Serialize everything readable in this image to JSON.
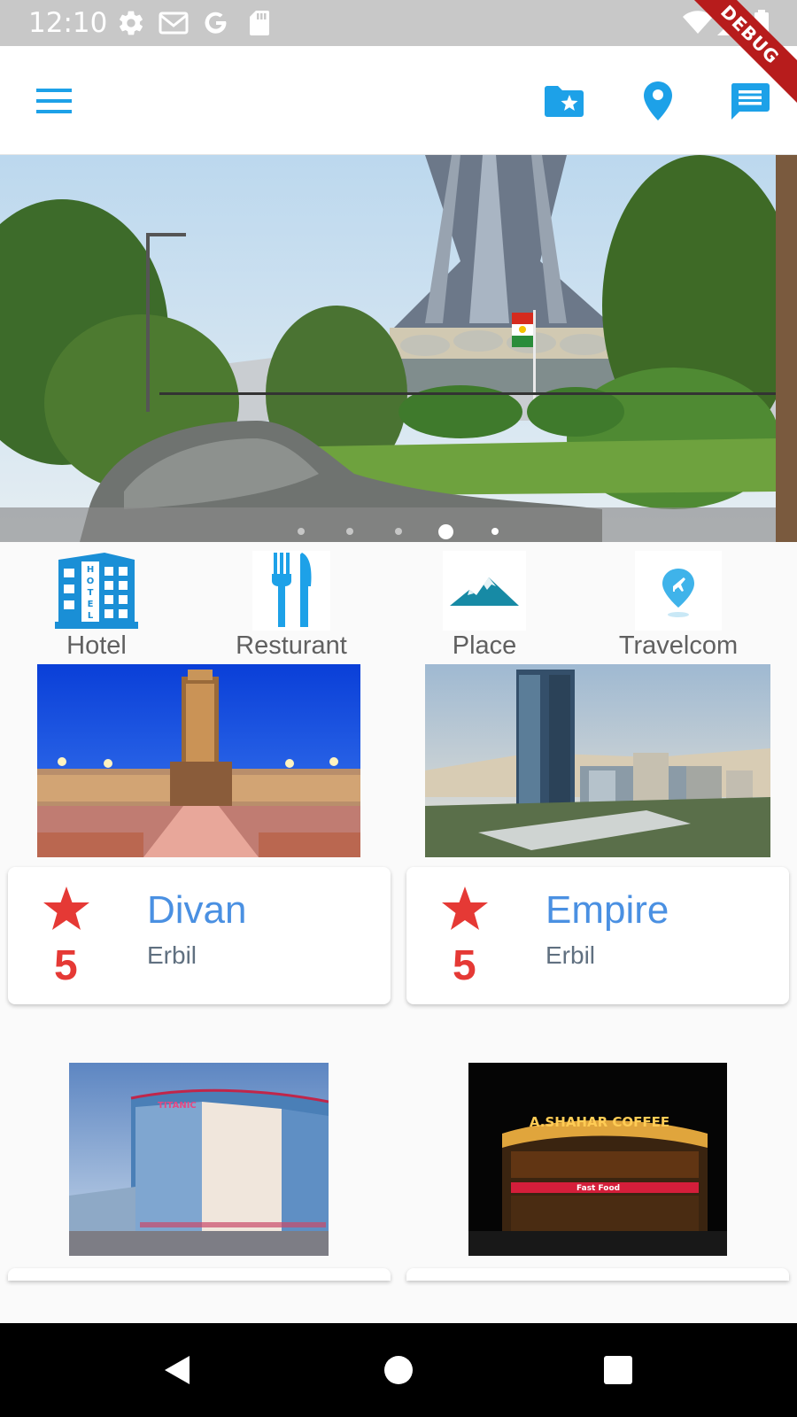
{
  "status_bar": {
    "time": "12:10",
    "icons": [
      "settings-icon",
      "gmail-icon",
      "google-icon",
      "sd-card-icon",
      "wifi-icon",
      "signal-icon",
      "battery-icon"
    ],
    "debug_label": "DEBUG"
  },
  "app_bar": {
    "icons": [
      "menu-icon",
      "favorite-folder-icon",
      "location-pin-icon",
      "message-icon"
    ],
    "accent": "#1da1e8"
  },
  "carousel": {
    "slide_count": 5,
    "active_index": 3,
    "image": "halabja-monument-photo"
  },
  "categories": [
    {
      "label": "Hotel",
      "icon": "hotel-building-icon"
    },
    {
      "label": "Resturant",
      "icon": "fork-knife-icon"
    },
    {
      "label": "Place",
      "icon": "mountain-icon"
    },
    {
      "label": "Travelcom",
      "icon": "airplane-pin-icon"
    }
  ],
  "listings": [
    {
      "name": "Divan",
      "city": "Erbil",
      "rating": "5",
      "image": "divan-hotel-photo"
    },
    {
      "name": "Empire",
      "city": "Erbil",
      "rating": "5",
      "image": "empire-tower-photo"
    },
    {
      "name": "",
      "city": "",
      "rating": "",
      "image": "titanic-hotel-photo",
      "sign": "TITANIC"
    },
    {
      "name": "",
      "city": "",
      "rating": "",
      "image": "shahar-coffee-photo",
      "sign": "A.SHAHAR COFFEE",
      "sub_sign": "Fast Food"
    }
  ],
  "colors": {
    "title_blue": "#4a90e2",
    "star_red": "#e53935",
    "icon_blue": "#1da1e8"
  },
  "nav_bar": {
    "icons": [
      "back-icon",
      "home-icon",
      "recents-icon"
    ]
  }
}
